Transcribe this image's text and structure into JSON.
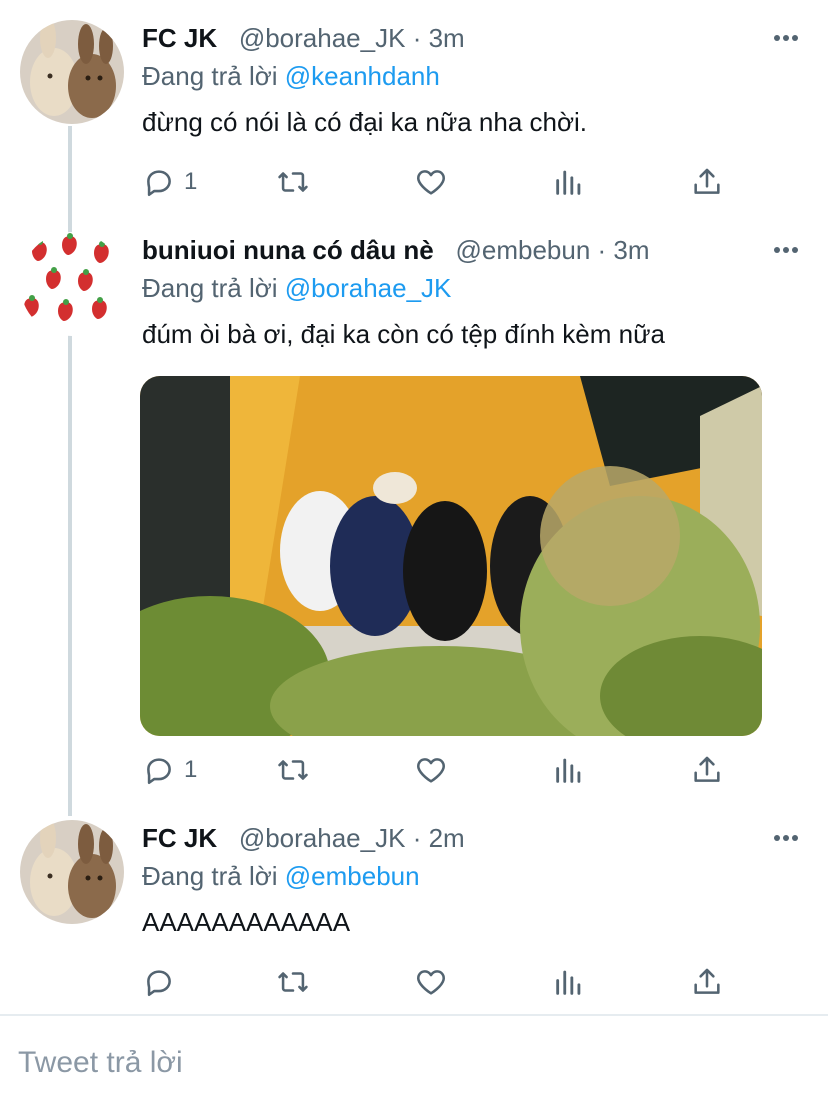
{
  "tweets": [
    {
      "display_name": "FC JK",
      "handle": "@borahae_JK",
      "time": "· 3m",
      "replying_prefix": "Đang trả lời ",
      "replying_to": "@keanhdanh",
      "text": "đừng có nói là có đại ka nữa nha chời.",
      "reply_count": "1",
      "avatar": "bunny-plush-avatar"
    },
    {
      "display_name": "buniuoi nuna có dâu nè",
      "handle": "@embebun",
      "time": "· 3m",
      "replying_prefix": "Đang trả lời ",
      "replying_to": "@borahae_JK",
      "text": "đúm òi bà ơi, đại ka còn có tệp đính kèm nữa",
      "reply_count": "1",
      "avatar": "strawberry-pattern-avatar",
      "media": "video-thumbnail-people-yellow-wall"
    },
    {
      "display_name": "FC JK",
      "handle": "@borahae_JK",
      "time": "· 2m",
      "replying_prefix": "Đang trả lời ",
      "replying_to": "@embebun",
      "text": "AAAAAAAAAAAA",
      "reply_count": "",
      "avatar": "bunny-plush-avatar"
    }
  ],
  "reply_box": {
    "placeholder": "Tweet trả lời"
  },
  "colors": {
    "accent": "#1d9bf0",
    "secondary_text": "#536471",
    "thread_line": "#cfd9de"
  }
}
